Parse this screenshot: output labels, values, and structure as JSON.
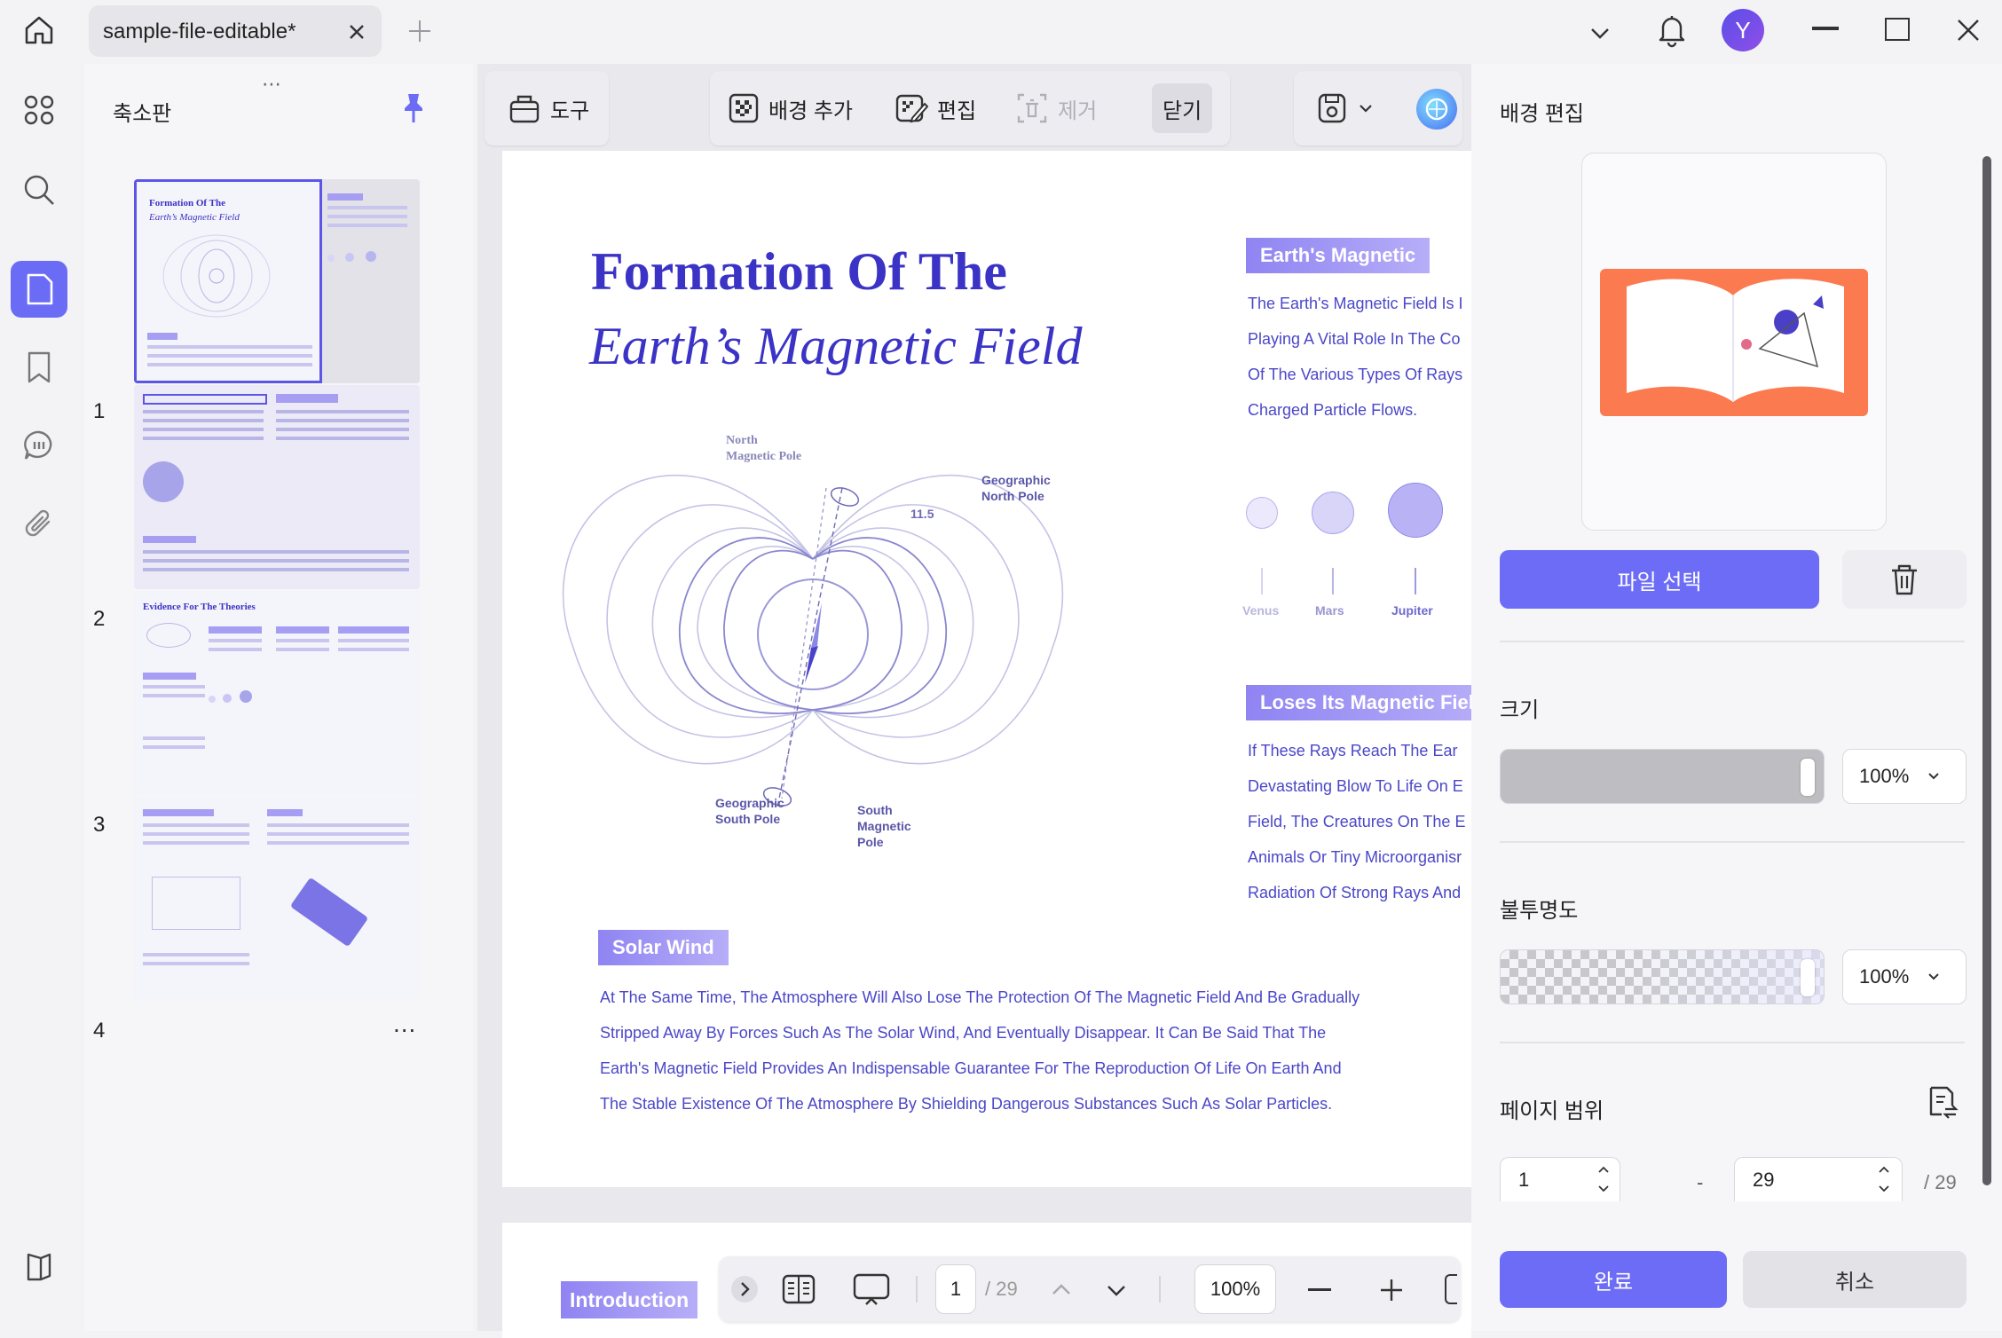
{
  "titlebar": {
    "tab_title": "sample-file-editable*",
    "avatar_letter": "Y"
  },
  "thumbnails": {
    "panel_title": "축소판",
    "pages": [
      {
        "number": "1",
        "more": "..."
      },
      {
        "number": "2",
        "more": "..."
      },
      {
        "number": "3",
        "more": "..."
      },
      {
        "number": "4",
        "more": "..."
      }
    ],
    "thumb3_heading": "Evidence For The Theories"
  },
  "toolbar": {
    "tools_label": "도구",
    "add_background": "배경 추가",
    "edit": "편집",
    "remove": "제거",
    "close": "닫기"
  },
  "page": {
    "title_line1": "Formation Of The",
    "title_line2": "Earth’s Magnetic Field",
    "badge_magnetic": "Earth's Magnetic",
    "magnetic_lines": [
      "The Earth's Magnetic Field Is I",
      "Playing A Vital Role In The Co",
      "Of The Various Types Of Rays",
      "Charged Particle Flows."
    ],
    "planets": [
      "Venus",
      "Mars",
      "Jupiter"
    ],
    "badge_loses": "Loses Its Magnetic Fiel",
    "loses_lines": [
      "If These Rays Reach The Ear",
      "Devastating Blow To Life On E",
      "Field, The Creatures On The E",
      "Animals Or Tiny Microorganisr",
      "Radiation Of Strong Rays And"
    ],
    "diagram": {
      "north_magnetic": [
        "North",
        "Magnetic Pole"
      ],
      "geographic_north": [
        "Geographic",
        "North Pole"
      ],
      "geographic_south": [
        "Geographic",
        "South Pole"
      ],
      "south_magnetic": [
        "South",
        "Magnetic",
        "Pole"
      ],
      "angle": "11.5"
    },
    "badge_solar": "Solar Wind",
    "solar_lines": [
      "At The Same Time, The Atmosphere Will Also Lose The Protection Of The Magnetic Field And Be Gradually",
      "Stripped Away By Forces Such As The Solar Wind, And Eventually Disappear. It Can Be Said That The",
      "Earth's Magnetic Field Provides An Indispensable Guarantee For The Reproduction Of Life On Earth And",
      "The Stable Existence Of The Atmosphere By Shielding Dangerous Substances Such As Solar Particles."
    ]
  },
  "bottombar": {
    "intro_badge": "Introduction",
    "current_page": "1",
    "total_pages": "/ 29",
    "zoom": "100%"
  },
  "rightpanel": {
    "title": "배경 편집",
    "choose_file": "파일 선택",
    "size_label": "크기",
    "size_value": "100%",
    "size_fraction": 1.0,
    "opacity_label": "불투명도",
    "opacity_value": "100%",
    "opacity_fraction": 1.0,
    "page_range_label": "페이지 범위",
    "range_from": "1",
    "range_dash": "-",
    "range_to": "29",
    "range_total": "/ 29",
    "done": "완료",
    "cancel": "취소"
  },
  "colors": {
    "accent": "#6d6cf6",
    "doc_text": "#4b47c8",
    "doc_title": "#3b33c5",
    "preview_orange": "#fb7a50"
  }
}
